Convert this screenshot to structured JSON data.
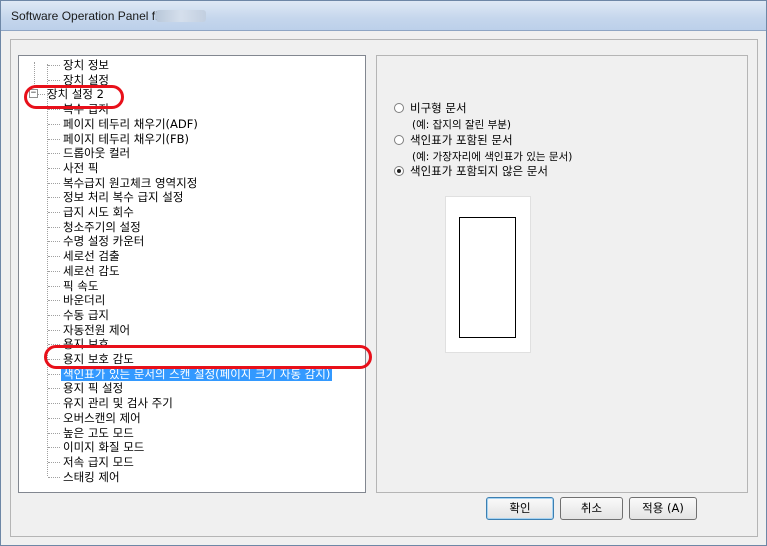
{
  "window": {
    "title": "Software Operation Panel fi-"
  },
  "tree": {
    "items": [
      {
        "label": "장치 정보",
        "level": 1
      },
      {
        "label": "장치 설정",
        "level": 1
      },
      {
        "label": "장치 설정 2",
        "level": 0,
        "expander": "−"
      },
      {
        "label": "복수 급지",
        "level": 1
      },
      {
        "label": "페이지 테두리 채우기(ADF)",
        "level": 1
      },
      {
        "label": "페이지 테두리 채우기(FB)",
        "level": 1
      },
      {
        "label": "드롭아웃 컬러",
        "level": 1
      },
      {
        "label": "사전 픽",
        "level": 1
      },
      {
        "label": "복수급지 원고체크 영역지정",
        "level": 1
      },
      {
        "label": "정보 처리 복수 급지 설정",
        "level": 1
      },
      {
        "label": "급지 시도 회수",
        "level": 1
      },
      {
        "label": "청소주기의 설정",
        "level": 1
      },
      {
        "label": "수명 설정 카운터",
        "level": 1
      },
      {
        "label": "세로선 검출",
        "level": 1
      },
      {
        "label": "세로선 감도",
        "level": 1
      },
      {
        "label": "픽 속도",
        "level": 1
      },
      {
        "label": "바운더리",
        "level": 1
      },
      {
        "label": "수동 급지",
        "level": 1
      },
      {
        "label": "자동전원 제어",
        "level": 1
      },
      {
        "label": "용지 보호",
        "level": 1
      },
      {
        "label": "용지 보호 감도",
        "level": 1
      },
      {
        "label": "색인표가 있는 문서의 스캔 설정(페이지 크기 자동 감지)",
        "level": 1,
        "selected": true
      },
      {
        "label": "용지 픽 설정",
        "level": 1
      },
      {
        "label": "유지 관리 및 검사 주기",
        "level": 1
      },
      {
        "label": "오버스캔의 제어",
        "level": 1
      },
      {
        "label": "높은 고도 모드",
        "level": 1
      },
      {
        "label": "이미지 화질 모드",
        "level": 1
      },
      {
        "label": "저속 급지 모드",
        "level": 1
      },
      {
        "label": "스태킹 제어",
        "level": 1
      }
    ]
  },
  "options": {
    "irregular": {
      "label": "비구형 문서",
      "note": "(예: 잡지의 잘린 부분)",
      "checked": false
    },
    "with_index": {
      "label": "색인표가 포함된 문서",
      "note": "(예: 가장자리에 색인표가 있는 문서)",
      "checked": false
    },
    "without_index": {
      "label": "색인표가 포함되지 않은 문서",
      "checked": true
    }
  },
  "buttons": {
    "ok": "확인",
    "cancel": "취소",
    "apply": "적용 (A)"
  },
  "colors": {
    "highlight": "#3399ff",
    "annotation": "#e8101a"
  }
}
